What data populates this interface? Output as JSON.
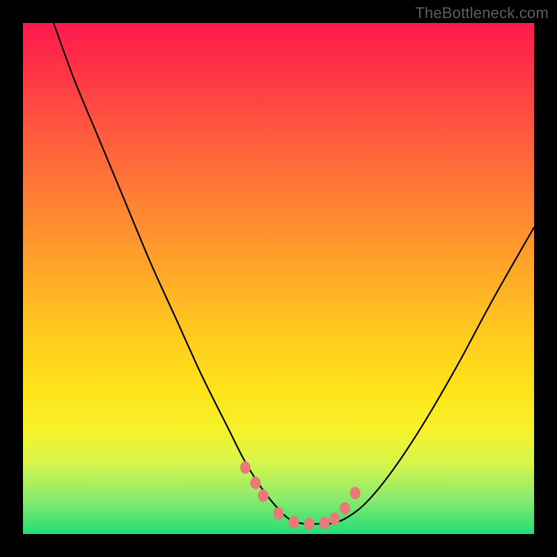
{
  "attribution": "TheBottleneck.com",
  "colors": {
    "frame": "#000000",
    "gradient_top": "#ff1a4d",
    "gradient_bottom": "#22dd77",
    "curve": "#000000",
    "markers": "#e87a7a"
  },
  "chart_data": {
    "type": "line",
    "title": "",
    "xlabel": "",
    "ylabel": "",
    "xlim": [
      0,
      100
    ],
    "ylim": [
      0,
      100
    ],
    "grid": false,
    "legend": false,
    "series": [
      {
        "name": "bottleneck-curve",
        "x": [
          6,
          10,
          15,
          20,
          25,
          30,
          35,
          40,
          43,
          46,
          49,
          52,
          55,
          58,
          60,
          63,
          67,
          72,
          78,
          85,
          92,
          100
        ],
        "y": [
          100,
          89,
          77,
          65,
          53,
          42,
          31,
          21,
          15,
          10,
          6,
          3,
          2,
          2,
          2,
          3,
          6,
          12,
          21,
          33,
          46,
          60
        ]
      }
    ],
    "markers": {
      "name": "highlight-dots",
      "x": [
        43.5,
        45.5,
        47.0,
        50.0,
        53.0,
        56.0,
        59.0,
        61.0,
        63.0,
        65.0
      ],
      "y": [
        13.0,
        10.0,
        7.5,
        4.0,
        2.3,
        2.0,
        2.2,
        3.0,
        5.0,
        8.0
      ]
    }
  }
}
